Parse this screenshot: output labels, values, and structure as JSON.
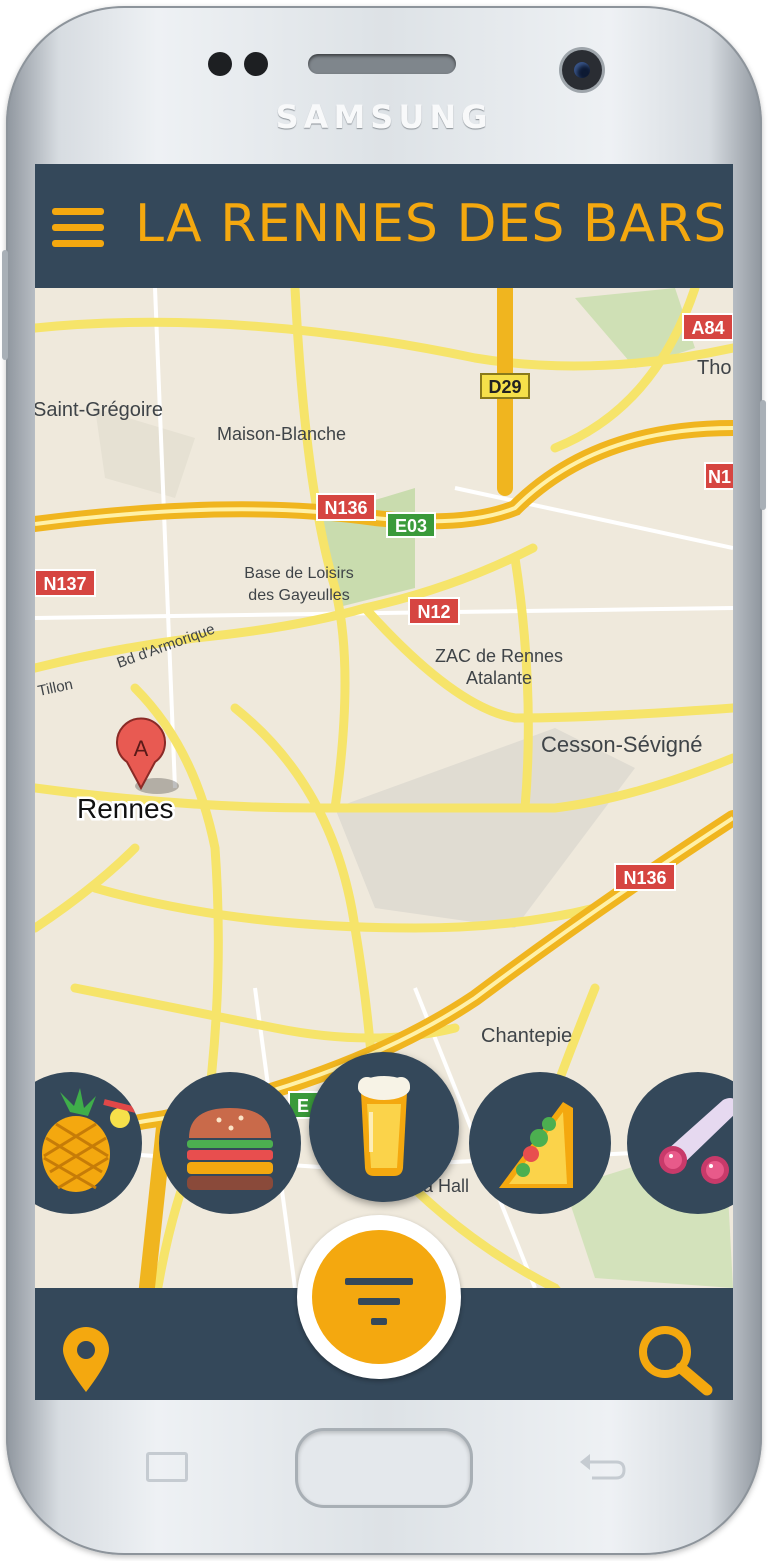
{
  "device": {
    "brand": "SAMSUNG"
  },
  "header": {
    "title": "LA RENNES DES BARS"
  },
  "map": {
    "marker_letter": "A",
    "places": {
      "saint_gregoire": "Saint-Grégoire",
      "maison_blanche": "Maison-Blanche",
      "base_loisirs_1": "Base de Loisirs",
      "base_loisirs_2": "des Gayeulles",
      "boulevard": "Bd d'Armorique",
      "tillon": "Tillon",
      "zac_1": "ZAC de Rennes",
      "zac_2": "Atalante",
      "cesson": "Cesson-Sévigné",
      "rennes": "Rennes",
      "chantepie": "Chantepie",
      "tho": "Tho",
      "la_hall": "a Hall"
    },
    "roads": {
      "n136_a": "N136",
      "e03": "E03",
      "n137": "N137",
      "n12": "N12",
      "d29": "D29",
      "a84": "A84",
      "n1": "N1",
      "n136_b": "N136",
      "e_partial": "E"
    }
  },
  "categories": [
    {
      "name": "cocktail",
      "icon": "pineapple-icon"
    },
    {
      "name": "burger",
      "icon": "burger-icon"
    },
    {
      "name": "beer",
      "icon": "beer-icon"
    },
    {
      "name": "sandwich",
      "icon": "sandwich-icon"
    },
    {
      "name": "charcuterie",
      "icon": "sausage-icon"
    }
  ],
  "bottom_bar": {
    "left_icon": "location-pin-icon",
    "center_icon": "filter-icon",
    "right_icon": "search-icon"
  },
  "colors": {
    "accent": "#f4a80f",
    "bar": "#34485a",
    "road": "#f6e46a",
    "highway": "#f0b51f"
  }
}
